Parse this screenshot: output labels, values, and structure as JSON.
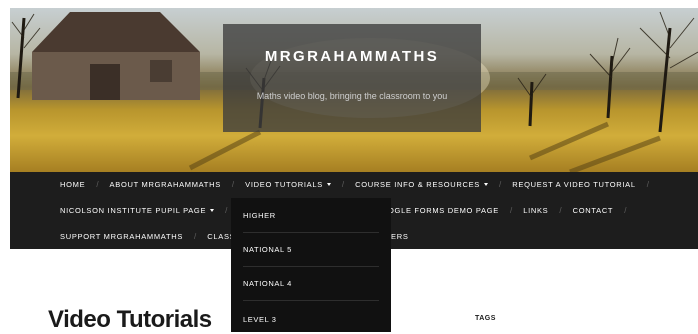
{
  "header": {
    "site_title": "MRGRAHAMMATHS",
    "tagline": "Maths video blog, bringing the classroom to you"
  },
  "nav": {
    "separator": "/",
    "row1": [
      {
        "label": "HOME"
      },
      {
        "label": "ABOUT MRGRAHAMMATHS"
      },
      {
        "label": "VIDEO TUTORIALS",
        "dropdown": true,
        "active": true
      },
      {
        "label": "COURSE INFO & RESOURCES",
        "dropdown": true
      },
      {
        "label": "REQUEST A VIDEO TUTORIAL"
      }
    ],
    "row2": [
      {
        "label": "NICOLSON INSTITUTE PUPIL PAGE",
        "dropdown": true
      },
      {
        "label": "I"
      },
      {
        "label": "OGLE FORMS DEMO PAGE"
      },
      {
        "label": "LINKS"
      },
      {
        "label": "CONTACT"
      }
    ],
    "row3": [
      {
        "label": "SUPPORT MRGRAHAMMATHS"
      },
      {
        "label": "CLASSV"
      },
      {
        "label": "ERS"
      }
    ]
  },
  "dropdown": {
    "items": [
      "HIGHER",
      "NATIONAL 5",
      "NATIONAL 4",
      "LEVEL 3"
    ]
  },
  "main": {
    "page_title": "Video Tutorials"
  },
  "sidebar": {
    "heading": "TAGS"
  },
  "colors": {
    "nav_bg": "#1d1d1d",
    "dropdown_bg": "#111111",
    "brand_box": "rgba(60,60,60,0.78)"
  }
}
